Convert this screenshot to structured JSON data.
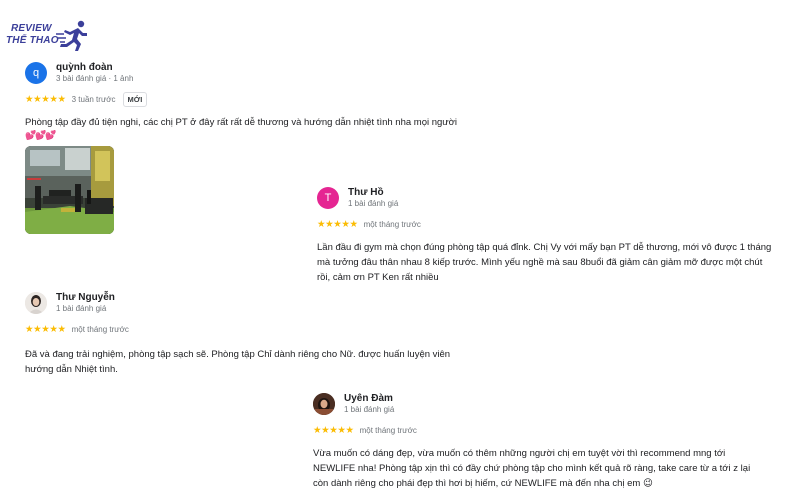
{
  "logo": {
    "line1": "REVIEW",
    "line2": "THỂ THAO",
    "color": "#3b3f9a"
  },
  "reviews": [
    {
      "avatar_letter": "q",
      "avatar_color": "#1a73e8",
      "name": "quỳnh đoàn",
      "meta": "3 bài đánh giá · 1 ảnh",
      "stars": "★★★★★",
      "rating": 5,
      "time": "3 tuần trước",
      "badge": "MỚI",
      "text": "Phòng tập đầy đủ tiện nghi, các chị PT ở đây rất rất dễ thương và hướng dẫn nhiệt tình nha mọi người",
      "emoji": "💕💕💕",
      "photo": "gym-interior-photo"
    },
    {
      "avatar_letter": "T",
      "avatar_color": "#e52592",
      "name": "Thư Hồ",
      "meta": "1 bài đánh giá",
      "stars": "★★★★★",
      "rating": 5,
      "time": "một tháng trước",
      "text": "Lần đầu đi gym mà chọn đúng phòng tập quá đỉnk. Chị Vy với mấy bạn PT dễ thương, mới vô được 1 tháng mà tưởng đâu thân nhau 8 kiếp trước. Mình yếu nghề mà sau 8buổi đã giảm cân giảm mỡ được một chút rồi, cảm ơn PT Ken rất nhiều"
    },
    {
      "avatar_color": "#d9d4cf",
      "name": "Thư Nguyễn",
      "meta": "1 bài đánh giá",
      "stars": "★★★★★",
      "rating": 5,
      "time": "một tháng trước",
      "text": "Đã và đang trải nghiệm, phòng tập sạch sẽ. Phòng tập Chỉ dành riêng cho Nữ. được huấn luyện viên hướng dẫn Nhiệt tình."
    },
    {
      "avatar_color": "#5a3a2a",
      "name": "Uyên Đàm",
      "meta": "1 bài đánh giá",
      "stars": "★★★★★",
      "rating": 5,
      "time": "một tháng trước",
      "text": "Vừa muốn có dáng đẹp, vừa muốn có thêm những người chị em tuyệt vời thì recommend mng tới NEWLIFE nha! Phòng tập xịn thì có đầy chứ phòng tập cho mình kết quả rõ ràng, take care từ a tới z lại còn dành riêng cho phái đẹp thì hơi bị hiếm, cứ NEWLIFE mà đến nha chị em 😉"
    }
  ]
}
